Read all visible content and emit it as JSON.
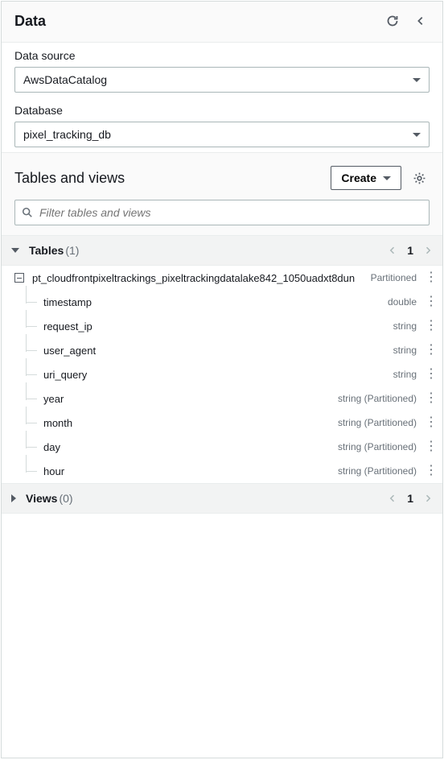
{
  "header": {
    "title": "Data"
  },
  "data_source": {
    "label": "Data source",
    "value": "AwsDataCatalog"
  },
  "database": {
    "label": "Database",
    "value": "pixel_tracking_db"
  },
  "tables_views": {
    "title": "Tables and views",
    "create_label": "Create",
    "filter_placeholder": "Filter tables and views"
  },
  "groups": {
    "tables": {
      "label": "Tables",
      "count": "(1)",
      "page": "1",
      "items": [
        {
          "name": "pt_cloudfrontpixeltrackings_pixeltrackingdatalake842_1050uadxt8dun",
          "badge": "Partitioned",
          "columns": [
            {
              "name": "timestamp",
              "type": "double"
            },
            {
              "name": "request_ip",
              "type": "string"
            },
            {
              "name": "user_agent",
              "type": "string"
            },
            {
              "name": "uri_query",
              "type": "string"
            },
            {
              "name": "year",
              "type": "string (Partitioned)"
            },
            {
              "name": "month",
              "type": "string (Partitioned)"
            },
            {
              "name": "day",
              "type": "string (Partitioned)"
            },
            {
              "name": "hour",
              "type": "string (Partitioned)"
            }
          ]
        }
      ]
    },
    "views": {
      "label": "Views",
      "count": "(0)",
      "page": "1"
    }
  }
}
